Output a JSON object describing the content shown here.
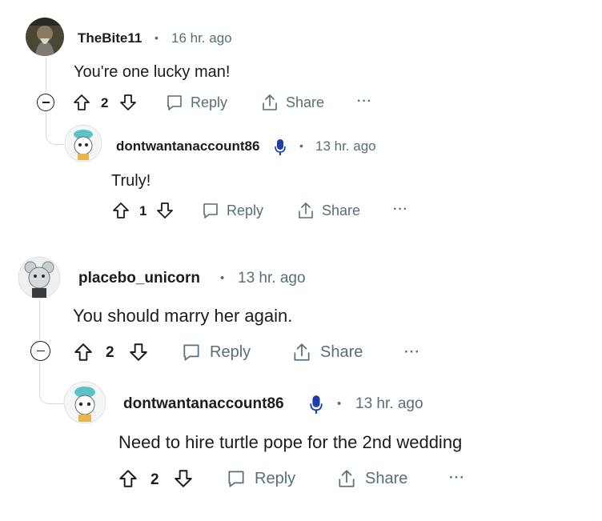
{
  "comments": [
    {
      "username": "TheBite11",
      "time": "16 hr. ago",
      "text": "You're one lucky man!",
      "votes": "2",
      "reply_label": "Reply",
      "share_label": "Share",
      "more_label": "···"
    },
    {
      "username": "dontwantanaccount86",
      "time": "13 hr. ago",
      "text": "Truly!",
      "votes": "1",
      "reply_label": "Reply",
      "share_label": "Share",
      "more_label": "···"
    },
    {
      "username": "placebo_unicorn",
      "time": "13 hr. ago",
      "text": "You should marry her again.",
      "votes": "2",
      "reply_label": "Reply",
      "share_label": "Share",
      "more_label": "···"
    },
    {
      "username": "dontwantanaccount86",
      "time": "13 hr. ago",
      "text": "Need to hire turtle pope for the 2nd wedding",
      "votes": "2",
      "reply_label": "Reply",
      "share_label": "Share",
      "more_label": "···"
    }
  ],
  "separator": "•",
  "colors": {
    "text": "#1c1c1c",
    "meta": "#576f76",
    "thread_line": "#d7dadc",
    "mic_badge": "#1a3fa8"
  }
}
